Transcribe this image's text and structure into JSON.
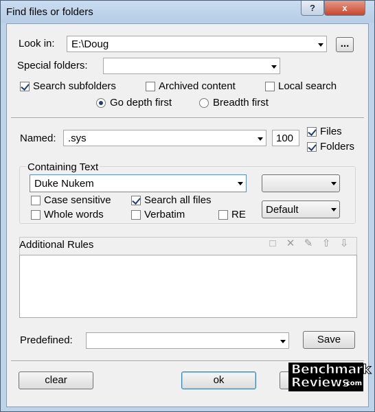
{
  "window": {
    "title": "Find files or folders",
    "help_label": "?",
    "close_label": "x"
  },
  "look_in": {
    "label": "Look in:",
    "value": "E:\\Doug",
    "browse_label": "..."
  },
  "special_folders": {
    "label": "Special folders:",
    "value": ""
  },
  "options": {
    "search_subfolders": {
      "label": "Search subfolders",
      "checked": true
    },
    "archived_content": {
      "label": "Archived content",
      "checked": false
    },
    "local_search": {
      "label": "Local search",
      "checked": false
    },
    "go_depth_first": {
      "label": "Go depth first",
      "selected": true
    },
    "breadth_first": {
      "label": "Breadth first",
      "selected": false
    }
  },
  "named": {
    "label": "Named:",
    "value": ".sys",
    "limit": "100"
  },
  "type_filter": {
    "files": {
      "label": "Files",
      "checked": true
    },
    "folders": {
      "label": "Folders",
      "checked": true
    }
  },
  "containing_text": {
    "label": "Containing Text",
    "value": "Duke Nukem",
    "encoding_value": "",
    "mode_value": "Default",
    "case_sensitive": {
      "label": "Case sensitive",
      "checked": false
    },
    "search_all_files": {
      "label": "Search all files",
      "checked": true
    },
    "whole_words": {
      "label": "Whole words",
      "checked": false
    },
    "verbatim": {
      "label": "Verbatim",
      "checked": false
    },
    "re": {
      "label": "RE",
      "checked": false
    }
  },
  "additional_rules": {
    "label": "Additional Rules",
    "toolbar_icons": [
      "new-rule-icon",
      "delete-rule-icon",
      "edit-rule-icon",
      "move-up-icon",
      "move-down-icon"
    ]
  },
  "predefined": {
    "label": "Predefined:",
    "value": "",
    "save_label": "Save"
  },
  "footer": {
    "clear_label": "clear",
    "ok_label": "ok",
    "cancel_label": ""
  },
  "watermark": {
    "line1": "Benchmark",
    "line2": "Reviews",
    "suffix": ".com"
  },
  "colors": {
    "frame": "#bcd3ea",
    "dialog_bg": "#f0f0f0",
    "close_button": "#c8452c",
    "check_mark": "#1e3e7a"
  }
}
